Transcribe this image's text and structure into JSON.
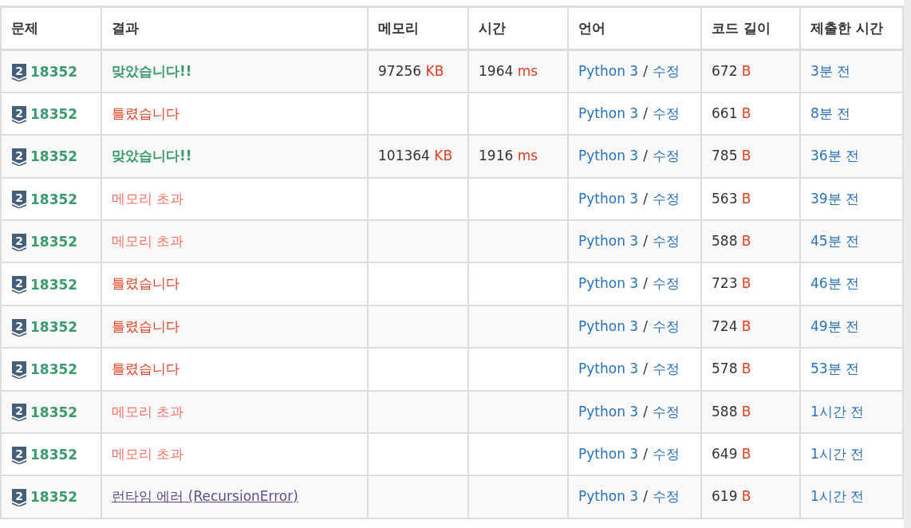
{
  "table": {
    "columns": [
      "문제",
      "결과",
      "메모리",
      "시간",
      "언어",
      "코드 길이",
      "제출한 시간"
    ],
    "rows": [
      {
        "tier": "2",
        "problem": "18352",
        "result": {
          "kind": "ac",
          "text": "맞았습니다!!"
        },
        "memory": {
          "value": "97256",
          "unit": "KB"
        },
        "time": {
          "value": "1964",
          "unit": "ms"
        },
        "language": "Python 3",
        "separator": "/",
        "edit": "수정",
        "length": {
          "value": "672",
          "unit": "B"
        },
        "submitted": "3분 전"
      },
      {
        "tier": "2",
        "problem": "18352",
        "result": {
          "kind": "wa",
          "text": "틀렸습니다"
        },
        "language": "Python 3",
        "separator": "/",
        "edit": "수정",
        "length": {
          "value": "661",
          "unit": "B"
        },
        "submitted": "8분 전"
      },
      {
        "tier": "2",
        "problem": "18352",
        "result": {
          "kind": "ac",
          "text": "맞았습니다!!"
        },
        "memory": {
          "value": "101364",
          "unit": "KB"
        },
        "time": {
          "value": "1916",
          "unit": "ms"
        },
        "language": "Python 3",
        "separator": "/",
        "edit": "수정",
        "length": {
          "value": "785",
          "unit": "B"
        },
        "submitted": "36분 전"
      },
      {
        "tier": "2",
        "problem": "18352",
        "result": {
          "kind": "mle",
          "text": "메모리 초과"
        },
        "language": "Python 3",
        "separator": "/",
        "edit": "수정",
        "length": {
          "value": "563",
          "unit": "B"
        },
        "submitted": "39분 전"
      },
      {
        "tier": "2",
        "problem": "18352",
        "result": {
          "kind": "mle",
          "text": "메모리 초과"
        },
        "language": "Python 3",
        "separator": "/",
        "edit": "수정",
        "length": {
          "value": "588",
          "unit": "B"
        },
        "submitted": "45분 전"
      },
      {
        "tier": "2",
        "problem": "18352",
        "result": {
          "kind": "wa",
          "text": "틀렸습니다"
        },
        "language": "Python 3",
        "separator": "/",
        "edit": "수정",
        "length": {
          "value": "723",
          "unit": "B"
        },
        "submitted": "46분 전"
      },
      {
        "tier": "2",
        "problem": "18352",
        "result": {
          "kind": "wa",
          "text": "틀렸습니다"
        },
        "language": "Python 3",
        "separator": "/",
        "edit": "수정",
        "length": {
          "value": "724",
          "unit": "B"
        },
        "submitted": "49분 전"
      },
      {
        "tier": "2",
        "problem": "18352",
        "result": {
          "kind": "wa",
          "text": "틀렸습니다"
        },
        "language": "Python 3",
        "separator": "/",
        "edit": "수정",
        "length": {
          "value": "578",
          "unit": "B"
        },
        "submitted": "53분 전"
      },
      {
        "tier": "2",
        "problem": "18352",
        "result": {
          "kind": "mle",
          "text": "메모리 초과"
        },
        "language": "Python 3",
        "separator": "/",
        "edit": "수정",
        "length": {
          "value": "588",
          "unit": "B"
        },
        "submitted": "1시간 전"
      },
      {
        "tier": "2",
        "problem": "18352",
        "result": {
          "kind": "mle",
          "text": "메모리 초과"
        },
        "language": "Python 3",
        "separator": "/",
        "edit": "수정",
        "length": {
          "value": "649",
          "unit": "B"
        },
        "submitted": "1시간 전"
      },
      {
        "tier": "2",
        "problem": "18352",
        "result": {
          "kind": "rte",
          "text": "런타임 에러 (RecursionError)"
        },
        "language": "Python 3",
        "separator": "/",
        "edit": "수정",
        "length": {
          "value": "619",
          "unit": "B"
        },
        "submitted": "1시간 전"
      }
    ]
  }
}
